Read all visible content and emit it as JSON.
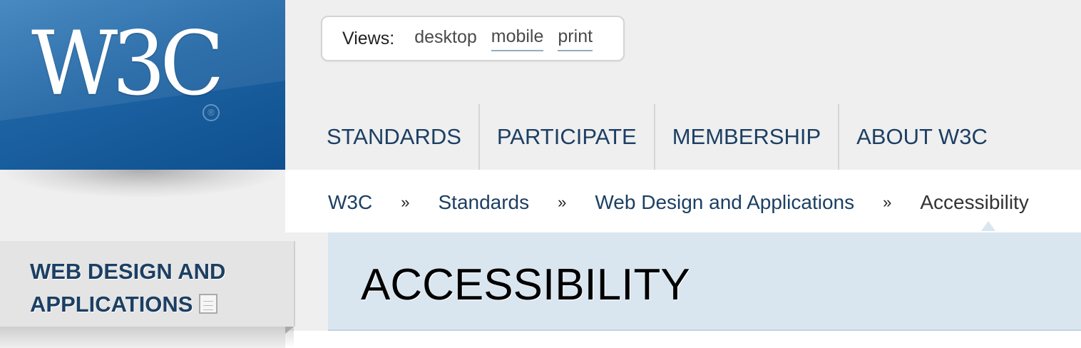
{
  "logo": {
    "text": "W3C",
    "registered": "®"
  },
  "views": {
    "label": "Views:",
    "options": [
      "desktop",
      "mobile",
      "print"
    ]
  },
  "nav": {
    "items": [
      "STANDARDS",
      "PARTICIPATE",
      "MEMBERSHIP",
      "ABOUT W3C"
    ]
  },
  "breadcrumb": {
    "items": [
      "W3C",
      "Standards",
      "Web Design and Applications"
    ],
    "separator": "»",
    "current": "Accessibility"
  },
  "page": {
    "title": "ACCESSIBILITY"
  },
  "sidebar": {
    "section_title_line1": "WEB DESIGN AND",
    "section_title_line2": "APPLICATIONS",
    "section_icon": "document-list-icon"
  },
  "colors": {
    "logo_blue": "#1d63a3",
    "nav_text": "#1c3f63",
    "title_band": "#d9e6f0",
    "background": "#efefef"
  }
}
